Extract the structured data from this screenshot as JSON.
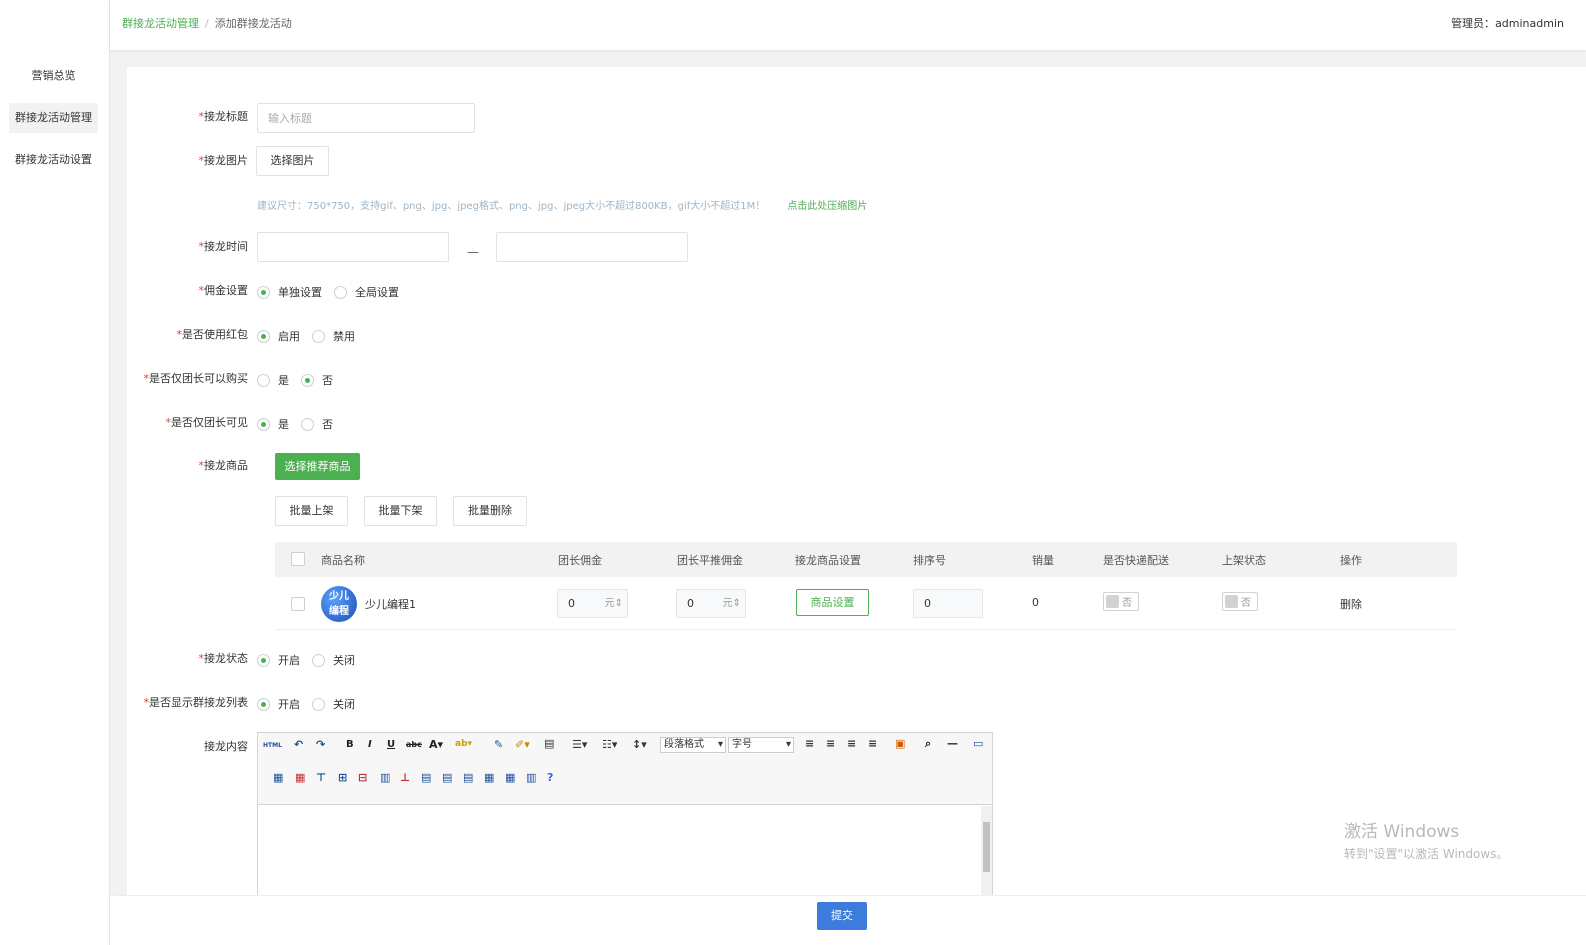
{
  "sidebar": {
    "items": [
      {
        "label": "营销总览"
      },
      {
        "label": "群接龙活动管理"
      },
      {
        "label": "群接龙活动设置"
      }
    ]
  },
  "header": {
    "breadcrumb": [
      "群接龙活动管理",
      "添加群接龙活动"
    ],
    "breadcrumb_sep": "/",
    "admin_label": "管理员：",
    "admin_name": "adminadmin"
  },
  "form": {
    "title_label": "接龙标题",
    "title_placeholder": "输入标题",
    "image_label": "接龙图片",
    "image_button": "选择图片",
    "image_hint": "建议尺寸：750*750，支持gif、png、jpg、jpeg格式、png、jpg、jpeg大小不超过800KB，gif大小不超过1M！",
    "image_hint_link": "点击此处压缩图片",
    "time_label": "接龙时间",
    "time_sep": "—",
    "commission_label": "佣金设置",
    "commission_options": [
      "单独设置",
      "全局设置"
    ],
    "redpack_label": "是否使用红包",
    "redpack_options": [
      "启用",
      "禁用"
    ],
    "leader_buy_label": "是否仅团长可以购买",
    "leader_buy_options": [
      "是",
      "否"
    ],
    "leader_visible_label": "是否仅团长可见",
    "leader_visible_options": [
      "是",
      "否"
    ],
    "goods_label": "接龙商品",
    "select_goods_button": "选择推荐商品",
    "batch_buttons": [
      "批量上架",
      "批量下架",
      "批量删除"
    ],
    "status_label": "接龙状态",
    "status_options": [
      "开启",
      "关闭"
    ],
    "show_list_label": "是否显示群接龙列表",
    "show_list_options": [
      "开启",
      "关闭"
    ],
    "content_label": "接龙内容"
  },
  "table": {
    "headers": [
      "商品名称",
      "团长佣金",
      "团长平推佣金",
      "接龙商品设置",
      "排序号",
      "销量",
      "是否快递配送",
      "上架状态",
      "操作"
    ],
    "rows": [
      {
        "avatar_text_1": "少儿",
        "avatar_text_2": "编程",
        "name": "少儿编程1",
        "commission": "0",
        "commission_unit": "元",
        "flat_commission": "0",
        "flat_unit": "元",
        "settings_button": "商品设置",
        "sort": "0",
        "sales": "0",
        "express": "否",
        "shelf": "否",
        "action": "删除"
      }
    ]
  },
  "editor": {
    "html_btn": "HTML",
    "format_select": "段落格式",
    "size_select": "字号"
  },
  "footer": {
    "submit": "提交"
  },
  "watermark": {
    "line1": "激活 Windows",
    "line2": "转到\"设置\"以激活 Windows。"
  },
  "colors": {
    "accent": "#4caf50",
    "primary": "#3d7bdc",
    "required": "#e53935"
  }
}
